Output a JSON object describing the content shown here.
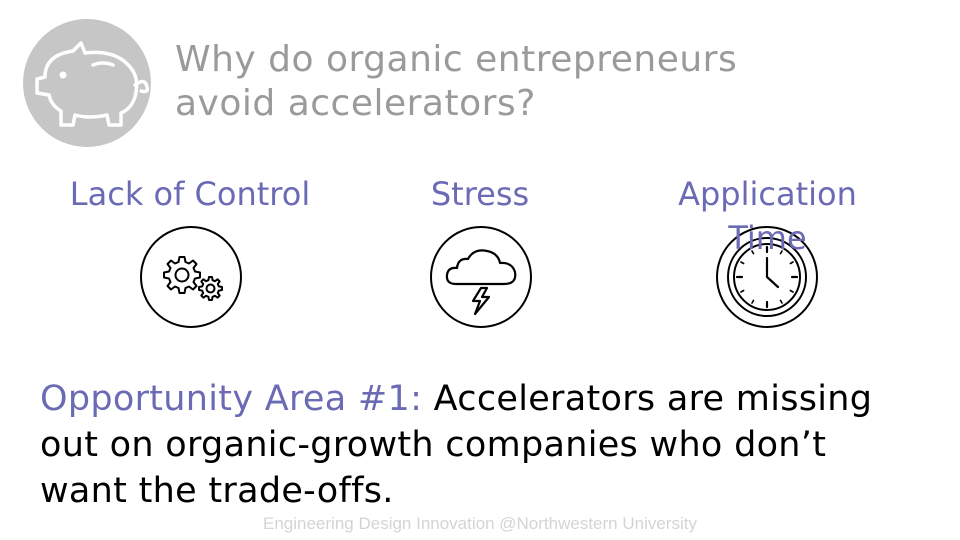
{
  "slide": {
    "title_line1": "Why do organic entrepreneurs",
    "title_line2": "avoid accelerators?",
    "reasons": [
      {
        "label": "Lack of Control",
        "icon": "gears-icon"
      },
      {
        "label": "Stress",
        "icon": "storm-cloud-icon"
      },
      {
        "label_line1": "Application",
        "label_line2": "Time",
        "icon": "clock-icon"
      }
    ],
    "opportunity_lead": "Opportunity Area #1:",
    "opportunity_text": " Accelerators are missing out on organic-growth companies who don’t want the trade-offs.",
    "footer": "Engineering Design Innovation @Northwestern University"
  },
  "colors": {
    "accent": "#6b6bb5",
    "title": "#9a9a9a",
    "piggy_circle": "#c6c6c6",
    "footer": "#d4d4d4"
  }
}
